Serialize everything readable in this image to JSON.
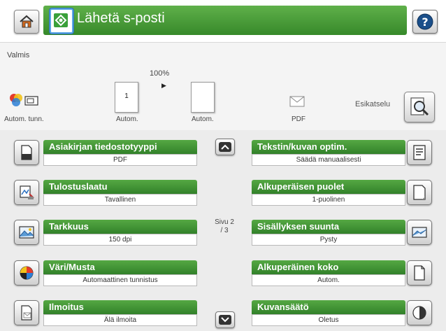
{
  "header": {
    "title": "Lähetä s-posti"
  },
  "status": {
    "text": "Valmis",
    "zoom": "100%"
  },
  "job_options": {
    "color_label": "Autom. tunn.",
    "sides_label": "Autom.",
    "page_number": "1",
    "page_label": "Autom.",
    "file_label": "PDF",
    "preview_label": "Esikatselu"
  },
  "settings_left": [
    {
      "title": "Asiakirjan tiedostotyyppi",
      "value": "PDF",
      "icon": "document-icon"
    },
    {
      "title": "Tulostuslaatu",
      "value": "Tavallinen",
      "icon": "quality-icon"
    },
    {
      "title": "Tarkkuus",
      "value": "150 dpi",
      "icon": "resolution-icon"
    },
    {
      "title": "Väri/Musta",
      "value": "Automaattinen tunnistus",
      "icon": "color-mono-icon"
    },
    {
      "title": "Ilmoitus",
      "value": "Älä ilmoita",
      "icon": "notification-icon"
    }
  ],
  "settings_right": [
    {
      "title": "Tekstin/kuvan optim.",
      "value": "Säädä manuaalisesti",
      "icon": "text-image-icon"
    },
    {
      "title": "Alkuperäisen puolet",
      "value": "1-puolinen",
      "icon": "sides-icon"
    },
    {
      "title": "Sisällyksen suunta",
      "value": "Pysty",
      "icon": "orientation-icon"
    },
    {
      "title": "Alkuperäinen koko",
      "value": "Autom.",
      "icon": "original-size-icon"
    },
    {
      "title": "Kuvansäätö",
      "value": "Oletus",
      "icon": "image-adjust-icon"
    }
  ],
  "pagination": {
    "line1": "Sivu 2",
    "line2": "/ 3"
  }
}
